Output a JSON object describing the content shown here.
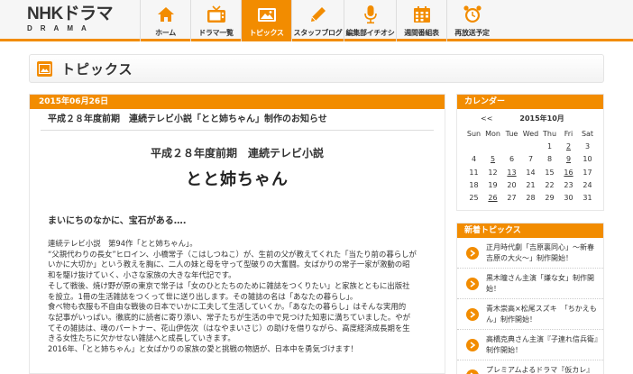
{
  "header": {
    "logo_top": "NHKドラマ",
    "logo_bottom": "DRAMA",
    "nav": [
      {
        "label": "ホーム",
        "icon": "home-icon",
        "active": false
      },
      {
        "label": "ドラマ一覧",
        "icon": "tv-icon",
        "active": false
      },
      {
        "label": "トピックス",
        "icon": "photo-icon",
        "active": true
      },
      {
        "label": "スタッフブログ",
        "icon": "pen-icon",
        "active": false
      },
      {
        "label": "編集部イチオシ",
        "icon": "microphone-icon",
        "active": false
      },
      {
        "label": "週間番組表",
        "icon": "calendar-icon",
        "active": false
      },
      {
        "label": "再放送予定",
        "icon": "alarm-clock-icon",
        "active": false
      }
    ],
    "accent_color": "#f28c00"
  },
  "page": {
    "title": "トピックス",
    "title_icon": "photo-icon"
  },
  "article": {
    "date": "2015年06月26日",
    "title": "平成２８年度前期　連続テレビ小説「とと姉ちゃん」制作のお知らせ",
    "heading_sub": "平成２８年度前期　連続テレビ小説",
    "heading_main": "とと姉ちゃん",
    "tagline": "まいにちのなかに、宝石がある….",
    "body_lines": [
      "連続テレビ小説　第94作「とと姉ちゃん」。",
      "“父親代わりの長女”ヒロイン、小橋常子（こはしつねこ）が、生前の父が教えてくれた「当たり前の暮らしが",
      "いかに大切か」という教えを胸に、二人の妹と母を守って型破りの大奮闘。女ばかりの常子一家が激動の昭",
      "和を駆け抜けていく、小さな家族の大きな年代記です。",
      "そして戦後、焼け野が原の東京で常子は「女のひとたちのために雑誌をつくりたい」と家族とともに出版社",
      "を設立。1冊の生活雑誌をつくって世に送り出します。その雑誌の名は「あなたの暮らし」。",
      "食べ物も衣服も不自由な戦後の日本でいかに工夫して生活していくか。「あなたの暮らし」はそんな実用的",
      "な記事がいっぱい。徹底的に読者に寄り添い、常子たちが生活の中で見つけた知恵に満ちていました。やが",
      "てその雑誌は、魂のパートナー、花山伊佐次（はなやまいさじ）の助けを借りながら、高度経済成長期を生",
      "きる女性たちに欠かせない雑誌へと成長していきます。",
      "2016年、「とと姉ちゃん」と女ばかりの家族の愛と挑戦の物語が、日本中を勇気づけます！"
    ]
  },
  "calendar": {
    "heading": "カレンダー",
    "prev": "<<",
    "month": "2015年10月",
    "weekdays": [
      "Sun",
      "Mon",
      "Tue",
      "Wed",
      "Thu",
      "Fri",
      "Sat"
    ],
    "weeks": [
      [
        "",
        "",
        "",
        "",
        "1",
        "2",
        "3"
      ],
      [
        "4",
        "5",
        "6",
        "7",
        "8",
        "9",
        "10"
      ],
      [
        "11",
        "12",
        "13",
        "14",
        "15",
        "16",
        "17"
      ],
      [
        "18",
        "19",
        "20",
        "21",
        "22",
        "23",
        "24"
      ],
      [
        "25",
        "26",
        "27",
        "28",
        "29",
        "30",
        "31"
      ]
    ],
    "linked_days": [
      "2",
      "5",
      "9",
      "13",
      "16",
      "26"
    ]
  },
  "news": {
    "heading": "新着トピックス",
    "items": [
      "正月時代劇「吉原裏同心」～新春吉原の大火～」制作開始！",
      "黒木瞳さん主演「嫌な女」制作開始！",
      "青木崇高×松尾スズキ　「ちかえもん」制作開始！",
      "高橋克典さん主演『子連れ信兵衛』制作開始！",
      "プレミアムよるドラマ『仮カレ』主題歌決定！"
    ]
  }
}
